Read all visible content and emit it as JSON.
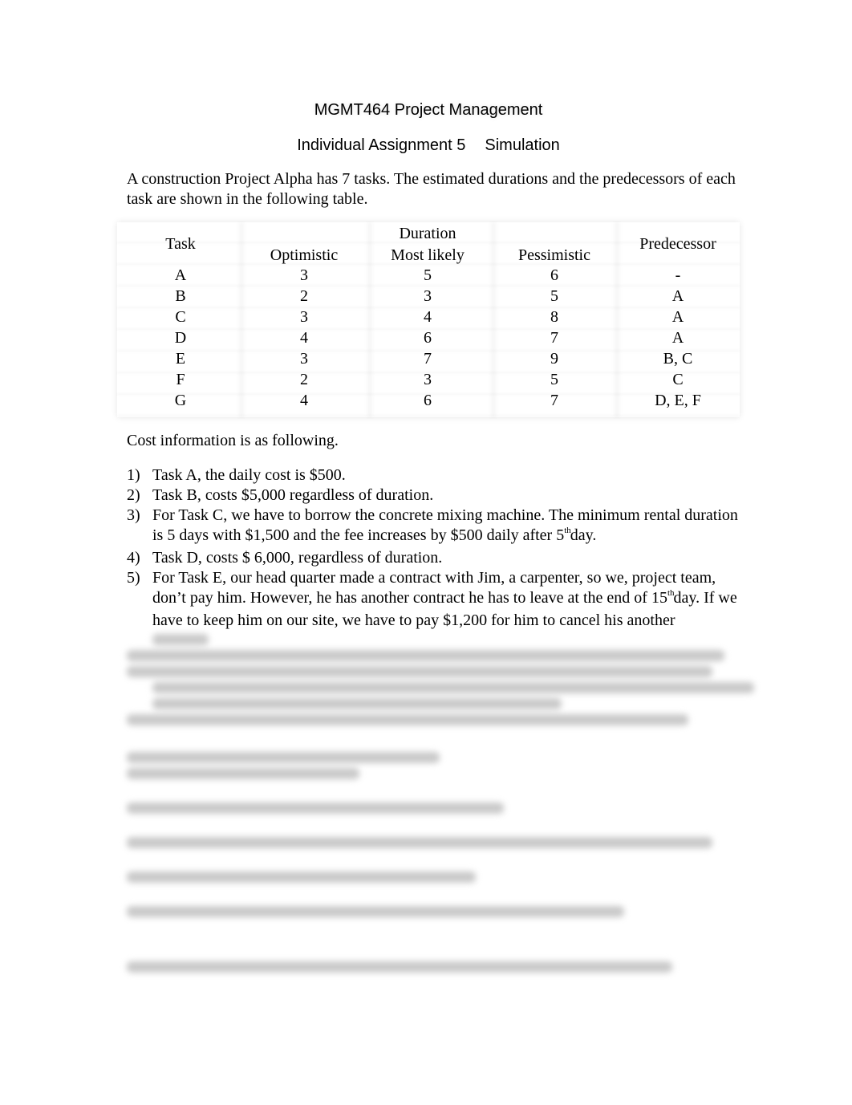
{
  "document": {
    "title": "MGMT464 Project Management",
    "subtitle_left": "Individual Assignment 5",
    "subtitle_right": "Simulation",
    "intro": "A construction Project Alpha has 7 tasks. The estimated durations and the predecessors of each task are shown in the following table."
  },
  "table": {
    "headers": {
      "task": "Task",
      "duration_group": "Duration",
      "optimistic": "Optimistic",
      "most_likely": "Most likely",
      "pessimistic": "Pessimistic",
      "predecessor": "Predecessor"
    },
    "rows": [
      {
        "task": "A",
        "optimistic": "3",
        "most_likely": "5",
        "pessimistic": "6",
        "predecessor": "-"
      },
      {
        "task": "B",
        "optimistic": "2",
        "most_likely": "3",
        "pessimistic": "5",
        "predecessor": "A"
      },
      {
        "task": "C",
        "optimistic": "3",
        "most_likely": "4",
        "pessimistic": "8",
        "predecessor": "A"
      },
      {
        "task": "D",
        "optimistic": "4",
        "most_likely": "6",
        "pessimistic": "7",
        "predecessor": "A"
      },
      {
        "task": "E",
        "optimistic": "3",
        "most_likely": "7",
        "pessimistic": "9",
        "predecessor": "B, C"
      },
      {
        "task": "F",
        "optimistic": "2",
        "most_likely": "3",
        "pessimistic": "5",
        "predecessor": "C"
      },
      {
        "task": "G",
        "optimistic": "4",
        "most_likely": "6",
        "pessimistic": "7",
        "predecessor": "D, E, F"
      }
    ]
  },
  "cost": {
    "intro": "Cost information is as following.",
    "items": [
      {
        "num": "1)",
        "text": "Task A, the daily cost is $500."
      },
      {
        "num": "2)",
        "text": "Task B, costs $5,000 regardless of duration."
      },
      {
        "num": "3)",
        "text_before": "For Task C, we have to borrow the concrete mixing machine. The minimum rental duration is 5 days with $1,500 and the fee increases by $500 daily after 5",
        "sup": "th",
        "text_after": " day."
      },
      {
        "num": "4)",
        "text": "Task D, costs $ 6,000, regardless of duration."
      },
      {
        "num": "5)",
        "text_before": "For Task E, our head quarter made a contract with Jim, a carpenter, so we, project team, don’t pay him. However, he has another contract he has to leave at the end of 15",
        "sup": "th",
        "text_after": " day. If we have to keep him on our site, we have to pay $1,200 for him to cancel his another"
      }
    ]
  }
}
